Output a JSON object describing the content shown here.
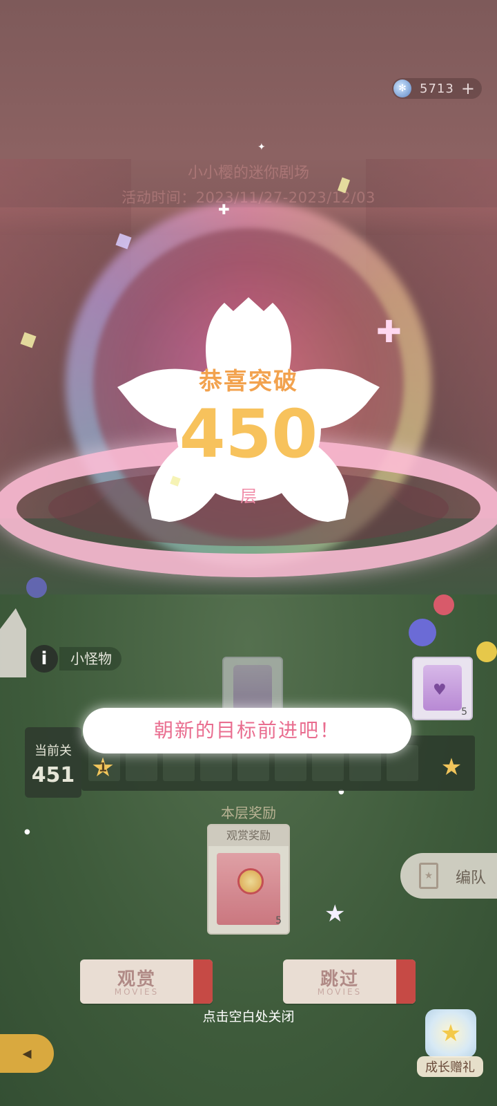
{
  "header": {
    "currency_icon": "snowflake-coin-icon",
    "currency_amount": "5713",
    "add_icon": "+"
  },
  "event": {
    "title": "小小樱的迷你剧场",
    "time": "活动时间：2023/11/27-2023/12/03"
  },
  "popup": {
    "heading": "恭喜突破",
    "floor": "450",
    "unit": "层",
    "banner": "朝新的目标前进吧！",
    "close_hint": "点击空白处关闭"
  },
  "side": {
    "info_icon": "i",
    "info_label": "小怪物"
  },
  "progress": {
    "current_label": "当前关",
    "current_level": "451",
    "star_count": "1",
    "next_reward_count": "5"
  },
  "reward": {
    "section_title": "本层奖励",
    "card_title": "观赏奖励",
    "count": "5"
  },
  "team": {
    "label": "编队"
  },
  "buttons": {
    "watch_label": "观赏",
    "watch_sub": "MOVIES",
    "skip_label": "跳过",
    "skip_sub": "MOVIES"
  },
  "gift": {
    "label": "成长赠礼"
  },
  "colors": {
    "accent_orange": "#f2a24e",
    "number_gold": "#f7c25c",
    "banner_pink": "#e96d8f",
    "ticket_red": "#c64a45"
  }
}
